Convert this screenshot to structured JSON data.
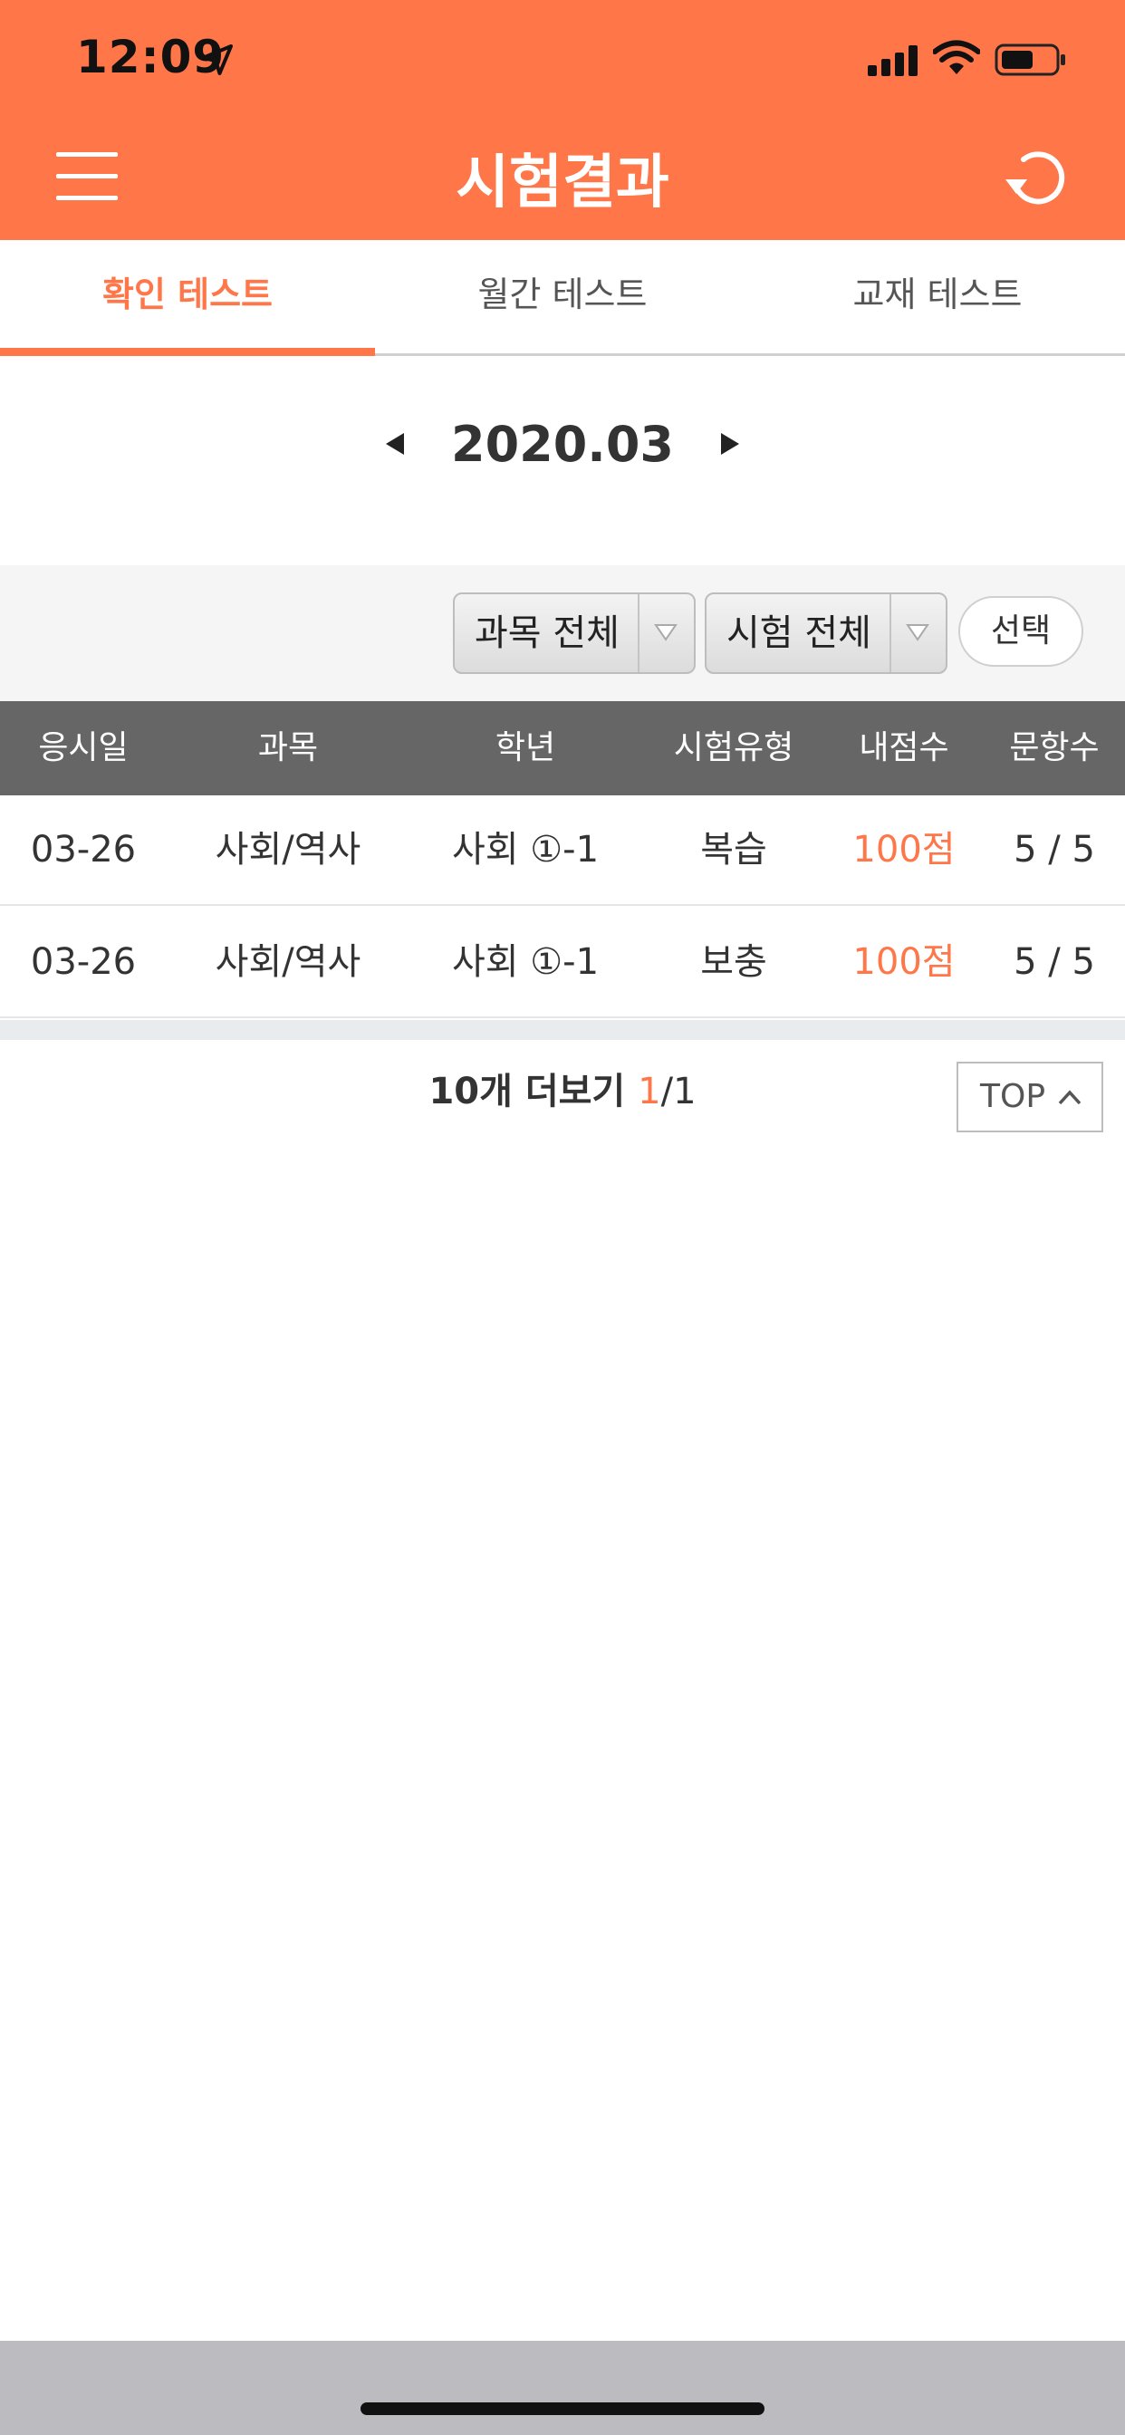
{
  "status_bar": {
    "time": "12:09"
  },
  "header": {
    "title": "시험결과"
  },
  "tabs": [
    {
      "label": "확인 테스트",
      "active": true
    },
    {
      "label": "월간 테스트",
      "active": false
    },
    {
      "label": "교재 테스트",
      "active": false
    }
  ],
  "month_nav": {
    "label": "2020.03"
  },
  "filters": {
    "subject_select": "과목 전체",
    "exam_select": "시험 전체",
    "select_button": "선택"
  },
  "table": {
    "columns": [
      "응시일",
      "과목",
      "학년",
      "시험유형",
      "내점수",
      "문항수"
    ],
    "rows": [
      [
        "03-26",
        "사회/역사",
        "사회 ①-1",
        "복습",
        "100점",
        "5 / 5"
      ],
      [
        "03-26",
        "사회/역사",
        "사회 ①-1",
        "보충",
        "100점",
        "5 / 5"
      ]
    ]
  },
  "pagination": {
    "more_label": "10개 더보기",
    "current": "1",
    "total": "/1"
  },
  "top_button": "TOP",
  "colors": {
    "accent": "#ff7649",
    "table_header": "#666666"
  }
}
